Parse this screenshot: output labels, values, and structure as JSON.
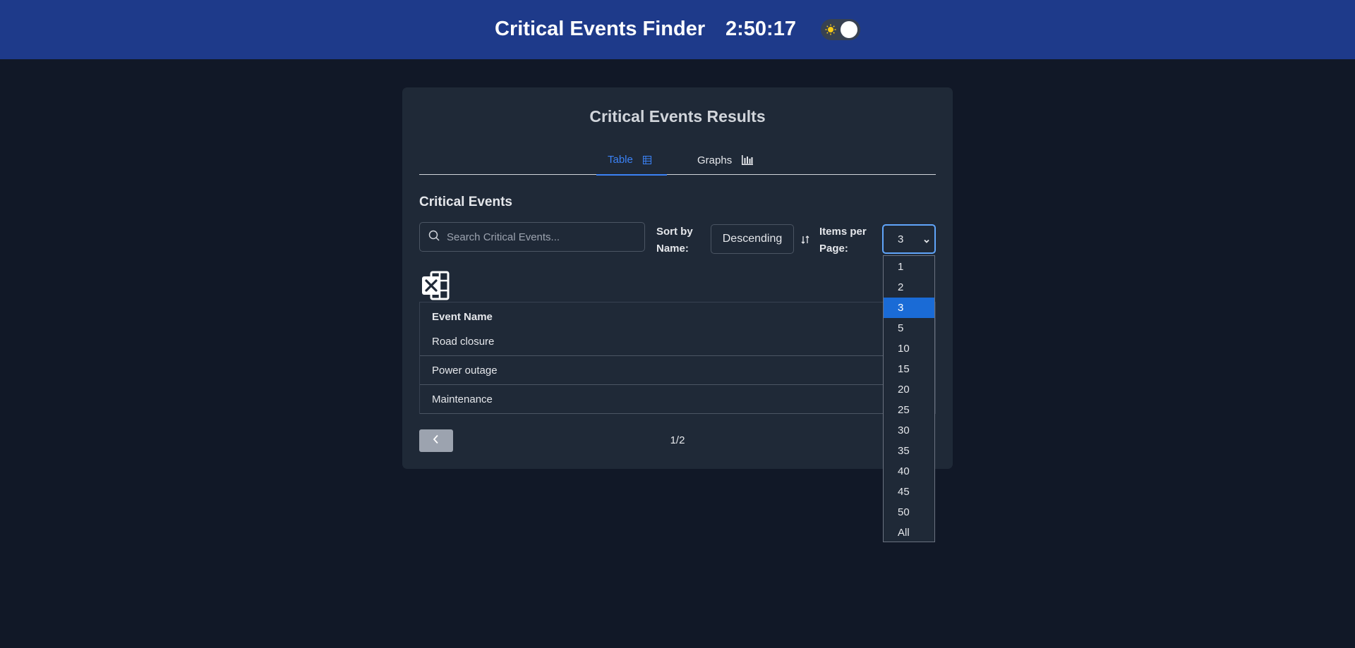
{
  "header": {
    "title": "Critical Events Finder",
    "clock": "2:50:17"
  },
  "card": {
    "title": "Critical Events Results",
    "tabs": [
      {
        "label": "Table",
        "icon": "table-icon",
        "active": true
      },
      {
        "label": "Graphs",
        "icon": "bar-chart-icon",
        "active": false
      }
    ],
    "section_title": "Critical Events",
    "search": {
      "placeholder": "Search Critical Events...",
      "value": ""
    },
    "sort": {
      "label": "Sort by Name:",
      "value": "Descending"
    },
    "items_per_page": {
      "label": "Items per Page:",
      "value": "3"
    },
    "table": {
      "columns": [
        "Event Name"
      ],
      "rows": [
        "Road closure",
        "Power outage",
        "Maintenance"
      ]
    },
    "pagination": {
      "page": "1/2"
    }
  },
  "dropdown": {
    "options": [
      "1",
      "2",
      "3",
      "5",
      "10",
      "15",
      "20",
      "25",
      "30",
      "35",
      "40",
      "45",
      "50",
      "All"
    ],
    "selected": "3"
  },
  "colors": {
    "header_bg": "#1e3a8a",
    "page_bg": "#111827",
    "card_bg": "#1f2937",
    "accent": "#3b82f6",
    "selected_option": "#1a6bd6"
  }
}
